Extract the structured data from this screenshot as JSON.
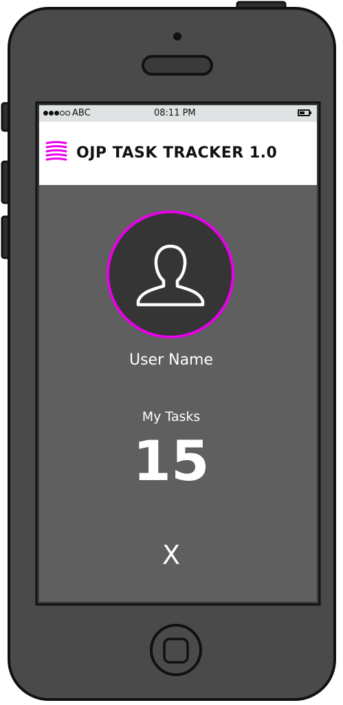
{
  "status_bar": {
    "carrier": "ABC",
    "time": "08:11 PM",
    "signal_bars_filled": 3,
    "signal_bars_total": 5,
    "battery_level": 0.6
  },
  "header": {
    "title": "OJP TASK TRACKER 1.0",
    "menu_icon": "menu-icon"
  },
  "profile": {
    "avatar_icon": "user-icon",
    "accent_color": "#e800e8",
    "user_name": "User Name"
  },
  "tasks": {
    "label": "My Tasks",
    "count": "15"
  },
  "actions": {
    "close_label": "X"
  }
}
